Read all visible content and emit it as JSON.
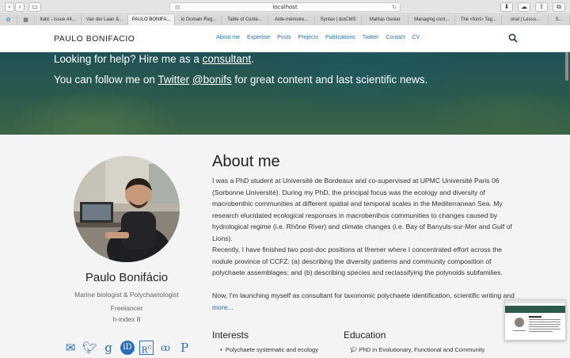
{
  "browser": {
    "url": "localhost",
    "tabs": [
      "Italic - Issue #4...",
      "Van der Laan &...",
      "PAULO BONIFA...",
      ".io Domain Reg...",
      "Table of Conte...",
      "Aide-mémoire...",
      "Syntax | dotCMS",
      "Mattias Geniar",
      "Managing cont...",
      "The <font> Tag...",
      "orial | Lesso...",
      "S..."
    ]
  },
  "site": {
    "brand": "PAULO BONIFACIO",
    "nav": [
      "About me",
      "Expertise",
      "Posts",
      "Projects",
      "Publications",
      "Twitter",
      "Contact",
      "CV"
    ]
  },
  "hero": {
    "line1_pre": "Looking for help? Hire me as a ",
    "line1_link": "consultant",
    "line1_post": ".",
    "line2_pre": "You can follow me on ",
    "line2_link1": "Twitter",
    "line2_link2": "@bonifs",
    "line2_post": " for great content and last scientific news."
  },
  "profile": {
    "name": "Paulo Bonifácio",
    "title": "Marine biologist & Polychaetologist",
    "status": "Freelancer",
    "hindex": "h-index 8",
    "social_icons": [
      "email-icon",
      "twitter-icon",
      "google-scholar-icon",
      "orcid-icon",
      "researchgate-icon",
      "mendeley-icon",
      "publons-icon"
    ]
  },
  "about": {
    "title": "About me",
    "p1": "I was a PhD student at Université de Bordeaux and co-supervised at UPMC Université Paris 06 (Sorbonne Université). During my PhD, the principal focus was the ecology and diversity of macrobenthic communities at different spatial and temporal scales in the Mediterranean Sea. My research elucidated ecological responses in macrobenthos communities to changes caused by hydrological regime (i.e. Rhône River) and climate changes (i.e. Bay of Banyuls-sur-Mer and Gulf of Lions).",
    "p2": "Recently, I have finished two post-doc positions at Ifremer where I concentrated effort across the nodule province of CCFZ: (a) describing the diversity patterns and community composition of polychaete assemblages; and (b) describing species and reclassifying the polynoids subfamilies.",
    "p3": "Now, I'm launching myself as consultant for taxonomic polychaete identification, scientific writing and ",
    "more": "more..."
  },
  "interests": {
    "title": "Interests",
    "items": [
      "Polychaete systematic and ecology"
    ]
  },
  "education": {
    "title": "Education",
    "items": [
      "PhD in Evolutionary, Functional and Community"
    ]
  }
}
